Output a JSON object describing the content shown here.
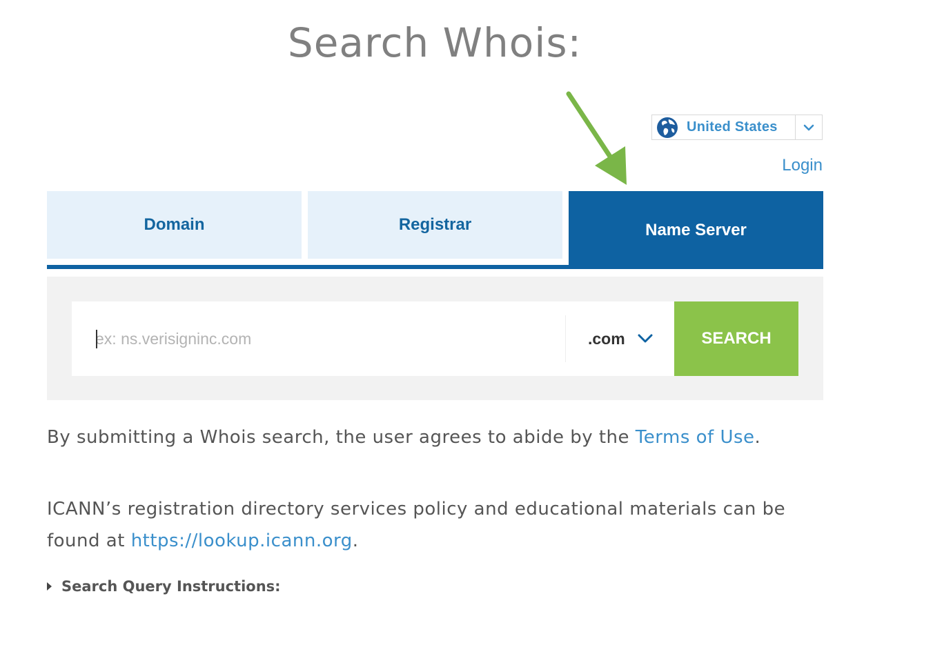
{
  "page": {
    "title": "Search Whois:"
  },
  "header": {
    "country": "United States",
    "login": "Login"
  },
  "tabs": [
    {
      "label": "Domain",
      "active": false
    },
    {
      "label": "Registrar",
      "active": false
    },
    {
      "label": "Name Server",
      "active": true
    }
  ],
  "search": {
    "placeholder": "ex: ns.verisigninc.com",
    "value": "",
    "tld": ".com",
    "button_label": "SEARCH"
  },
  "notice": {
    "terms_prefix": "By submitting a Whois search, the user agrees to abide by the ",
    "terms_link": "Terms of Use",
    "terms_suffix": ".",
    "icann_prefix": "ICANN’s registration directory services policy and educational materials can be found at ",
    "icann_link": "https://lookup.icann.org",
    "icann_suffix": "."
  },
  "instructions": {
    "label": "Search Query Instructions:"
  },
  "colors": {
    "primary_blue": "#0e62a2",
    "tab_inactive_bg": "#e6f1fa",
    "link_blue": "#3a8fcb",
    "search_green": "#8bc34a",
    "annotation_arrow": "#7ab648",
    "panel_bg": "#f2f2f2",
    "title_gray": "#808080"
  },
  "icons": {
    "globe": "globe-icon",
    "country_chevron": "chevron-down-icon",
    "tld_chevron": "chevron-down-icon",
    "annotation": "arrow-annotation-icon",
    "instructions_caret": "caret-right-icon"
  }
}
